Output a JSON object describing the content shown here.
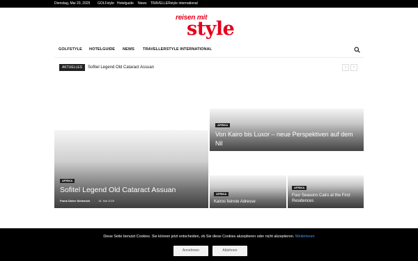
{
  "topbar": {
    "date": "Dienstag, Mai 20, 2025",
    "links": [
      "GOLFstyle",
      "Hotelguide",
      "News",
      "TRAVELLERstyle international"
    ]
  },
  "logo": {
    "top": "reisen mit",
    "main": "style"
  },
  "nav": {
    "items": [
      "GOLFSTYLE",
      "HOTELGUIDE",
      "NEWS",
      "TRAVELLERSTYLE INTERNATIONAL"
    ],
    "search_icon": "search-icon"
  },
  "ticker": {
    "badge": "AKTUELLES",
    "headline": "Sofitel Legend Old Cataract Assuan",
    "prev": "‹",
    "next": "›"
  },
  "grid": {
    "big": {
      "category": "AFRIKA",
      "title": "Sofitel Legend Old Cataract Assuan",
      "author": "Frank Dieter Sietemich",
      "separator": "-",
      "date": "18. Mai 2025"
    },
    "top": {
      "category": "AFRIKA",
      "title": "Von Kairo bis Luxor – neue Perspektiven auf dem Nil"
    },
    "small1": {
      "category": "AFRIKA",
      "title": "Kairos feinste Adresse"
    },
    "small2": {
      "category": "AFRIKA",
      "title": "Four Seasons Cairo at the First Residences"
    }
  },
  "cookie": {
    "text": "Diese Seite benutzt Cookies. Sie können jetzt entscheiden, ob Sie diese Cookies akzeptieren oder nicht akzeptieren.",
    "link": "Weiterlesen",
    "accept": "Annehmen",
    "decline": "Ablehnen"
  },
  "colors": {
    "brand": "#e4001b",
    "link": "#4a9fe8",
    "bar": "#000000"
  }
}
